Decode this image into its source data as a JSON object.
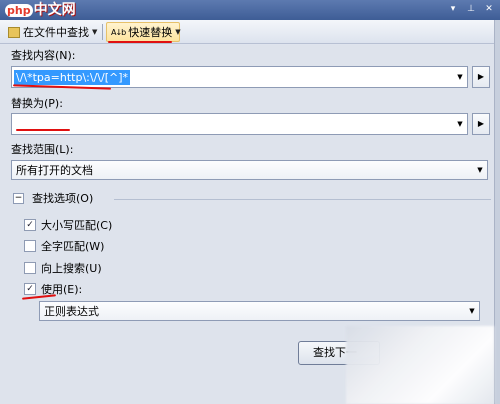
{
  "logo": {
    "php": "php",
    "cn": "中文网"
  },
  "toolbar": {
    "find_in_files": "在文件中查找",
    "quick_replace": "快速替换",
    "quick_replace_icon_text": "A↓b"
  },
  "find": {
    "label": "查找内容(N):",
    "value": "\\/\\*tpa=http\\:\\/\\/[^]*"
  },
  "replace": {
    "label": "替换为(P):",
    "value": ""
  },
  "scope": {
    "label": "查找范围(L):",
    "value": "所有打开的文档"
  },
  "options": {
    "header": "查找选项(O)",
    "match_case": {
      "label": "大小写匹配(C)",
      "checked": true
    },
    "whole_word": {
      "label": "全字匹配(W)",
      "checked": false
    },
    "search_up": {
      "label": "向上搜索(U)",
      "checked": false
    },
    "use": {
      "label": "使用(E):",
      "checked": true
    },
    "use_mode": "正则表达式"
  },
  "buttons": {
    "find_next": "查找下一"
  },
  "colors": {
    "selection": "#3399ff",
    "annotation": "#e01010",
    "panel": "#dee3ec"
  }
}
